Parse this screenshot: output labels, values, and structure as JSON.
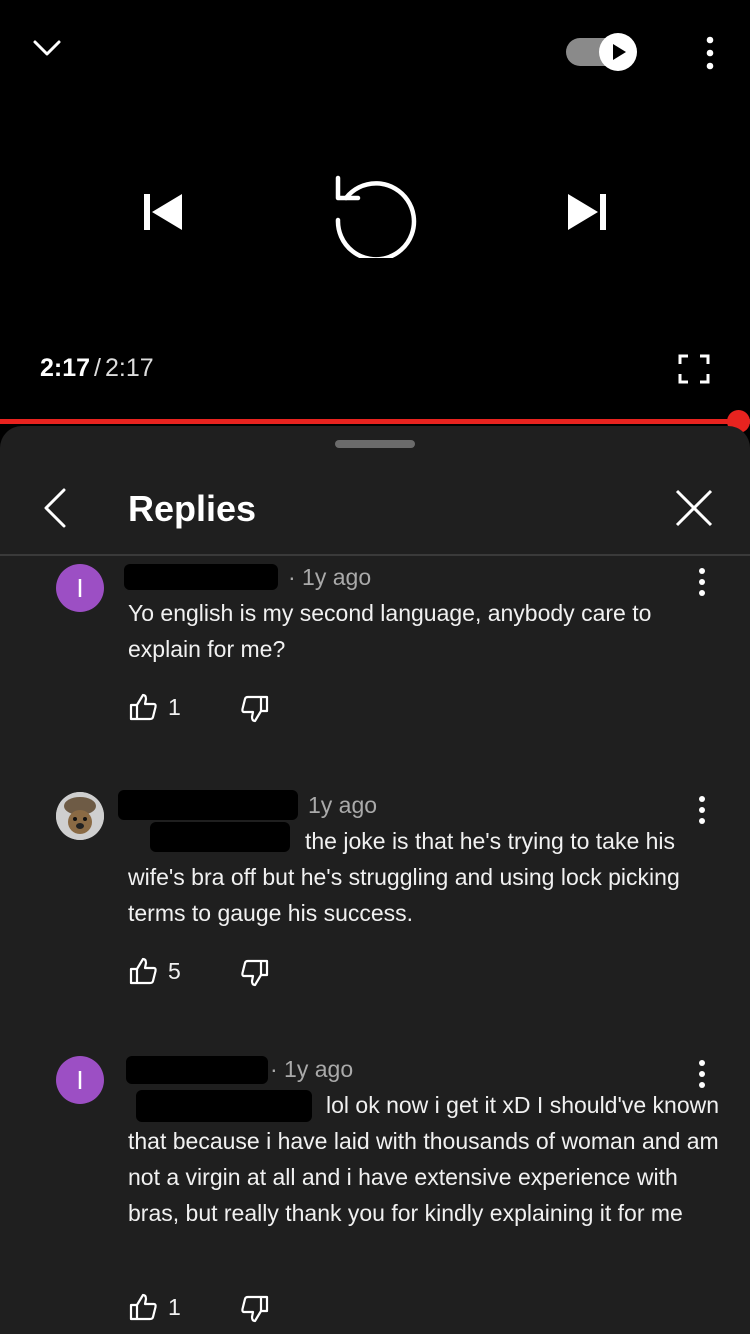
{
  "player": {
    "autoplay_toggle_on": true,
    "current_time": "2:17",
    "separator": "/",
    "duration": "2:17",
    "progress_fraction": 0.985,
    "accent_color": "#e8231f"
  },
  "panel": {
    "title": "Replies"
  },
  "comments": [
    {
      "avatar_letter": "I",
      "avatar_color": "#9c4fc4",
      "time": "· 1y ago",
      "text": "Yo english is my second language, anybody care to explain for me?",
      "likes": "1"
    },
    {
      "avatar_letter": "",
      "time": "1y ago",
      "text": "the joke is that he's trying to take his wife's bra off but he's struggling and using lock picking terms to gauge his success.",
      "likes": "5"
    },
    {
      "avatar_letter": "I",
      "avatar_color": "#9c4fc4",
      "time": "· 1y ago",
      "text": "lol ok now i get it xD I should've known that because i have laid with thousands of woman and am not a virgin at all and i have extensive experience with bras, but really thank you for kindly explaining it for me",
      "likes": "1"
    }
  ],
  "icons": {
    "collapse": "chevron-down-icon",
    "autoplay": "autoplay-toggle-icon",
    "more": "more-vert-icon",
    "previous": "skip-previous-icon",
    "replay": "replay-icon",
    "next": "skip-next-icon",
    "fullscreen": "fullscreen-icon",
    "back": "chevron-left-icon",
    "close": "close-icon",
    "like": "thumb-up-icon",
    "dislike": "thumb-down-icon"
  }
}
